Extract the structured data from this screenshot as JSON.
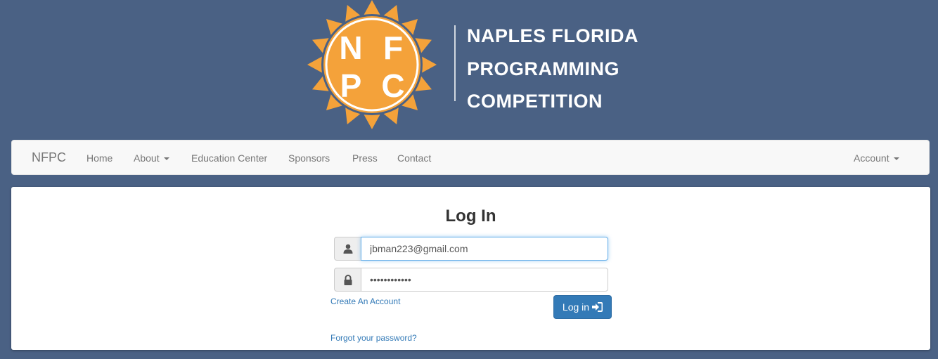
{
  "logo": {
    "letters": [
      "N",
      "F",
      "P",
      "C"
    ],
    "title_lines": [
      "NAPLES FLORIDA",
      "PROGRAMMING",
      "COMPETITION"
    ],
    "sun_color": "#f4a23a",
    "icon": "nfpc-sun-logo"
  },
  "nav": {
    "brand": "NFPC",
    "items": [
      {
        "label": "Home"
      },
      {
        "label": "About",
        "dropdown": true
      },
      {
        "label": "Education Center"
      },
      {
        "label": "Sponsors"
      },
      {
        "label": "Press"
      },
      {
        "label": "Contact"
      }
    ],
    "account": {
      "label": "Account",
      "dropdown": true
    }
  },
  "login": {
    "title": "Log In",
    "email_value": "jbman223@gmail.com",
    "password_value": "••••••••••••",
    "create_account": "Create An Account",
    "forgot_password": "Forgot your password?",
    "submit_label": "Log in",
    "user_icon": "user-icon",
    "lock_icon": "lock-icon",
    "submit_icon": "sign-in-icon"
  },
  "colors": {
    "background": "#4a6184",
    "primary": "#337ab7",
    "link": "#337ab7",
    "logo_orange": "#f4a23a"
  }
}
